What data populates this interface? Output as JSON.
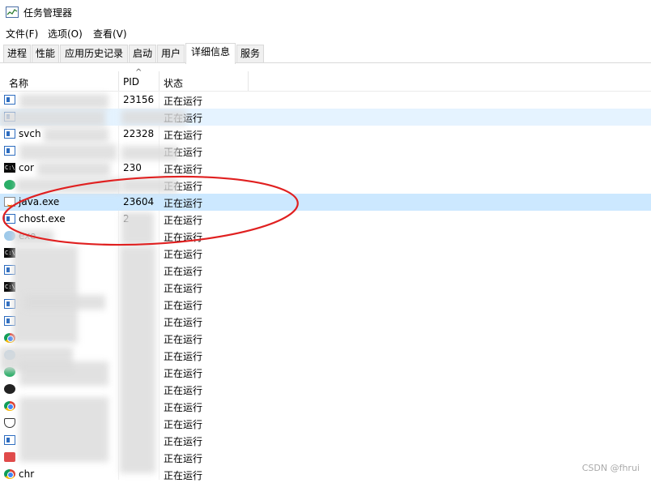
{
  "window": {
    "title": "任务管理器"
  },
  "menu": {
    "file": "文件(F)",
    "options": "选项(O)",
    "view": "查看(V)"
  },
  "tabs": [
    {
      "label": "进程"
    },
    {
      "label": "性能"
    },
    {
      "label": "应用历史记录"
    },
    {
      "label": "启动"
    },
    {
      "label": "用户"
    },
    {
      "label": "详细信息",
      "active": true
    },
    {
      "label": "服务"
    }
  ],
  "columns": {
    "name": "名称",
    "pid": "PID",
    "status": "状态"
  },
  "rows": [
    {
      "icon": "window-icon",
      "name": "",
      "pid": "23156",
      "status": "正在运行"
    },
    {
      "icon": "window-icon",
      "name": "",
      "pid": "",
      "status": "正在运行"
    },
    {
      "icon": "window-icon",
      "name": "svch",
      "pid": "22328",
      "status": "正在运行"
    },
    {
      "icon": "window-icon",
      "name": "",
      "pid": "",
      "status": "正在运行"
    },
    {
      "icon": "console-icon",
      "name": "cor",
      "pid": "230",
      "status": "正在运行"
    },
    {
      "icon": "wechat-icon",
      "name": "",
      "pid": "",
      "status": "正在运行"
    },
    {
      "icon": "java-icon",
      "name": "java.exe",
      "pid": "23604",
      "status": "正在运行"
    },
    {
      "icon": "window-icon",
      "name": "chost.exe",
      "pid": "2",
      "status": "正在运行"
    },
    {
      "icon": "cloud-icon",
      "name": "exe",
      "pid": "",
      "status": "正在运行"
    },
    {
      "icon": "console-icon",
      "name": "",
      "pid": "",
      "status": "正在运行"
    },
    {
      "icon": "window-icon",
      "name": "",
      "pid": "",
      "status": "正在运行"
    },
    {
      "icon": "console-icon",
      "name": "",
      "pid": "",
      "status": "正在运行"
    },
    {
      "icon": "window-icon",
      "name": "",
      "pid": "",
      "status": "正在运行"
    },
    {
      "icon": "window-icon",
      "name": "",
      "pid": "",
      "status": "正在运行"
    },
    {
      "icon": "chrome-icon",
      "name": "",
      "pid": "",
      "status": "正在运行"
    },
    {
      "icon": "cloud-icon",
      "name": "",
      "pid": "",
      "status": "正在运行"
    },
    {
      "icon": "wechat-icon",
      "name": "",
      "pid": "",
      "status": "正在运行"
    },
    {
      "icon": "dark-circle-icon",
      "name": "",
      "pid": "",
      "status": "正在运行"
    },
    {
      "icon": "chrome-icon",
      "name": "",
      "pid": "",
      "status": "正在运行"
    },
    {
      "icon": "shield-icon",
      "name": "",
      "pid": "",
      "status": "正在运行"
    },
    {
      "icon": "window-icon",
      "name": "",
      "pid": "",
      "status": "正在运行"
    },
    {
      "icon": "red-app-icon",
      "name": "",
      "pid": "",
      "status": "正在运行"
    },
    {
      "icon": "chrome-icon",
      "name": "chr",
      "pid": "",
      "status": "正在运行"
    }
  ],
  "selected_row": 6,
  "watermark": "CSDN @fhrui",
  "colors": {
    "selection": "#cce8ff",
    "hover": "#e5f3ff",
    "annotation": "#e02020"
  }
}
